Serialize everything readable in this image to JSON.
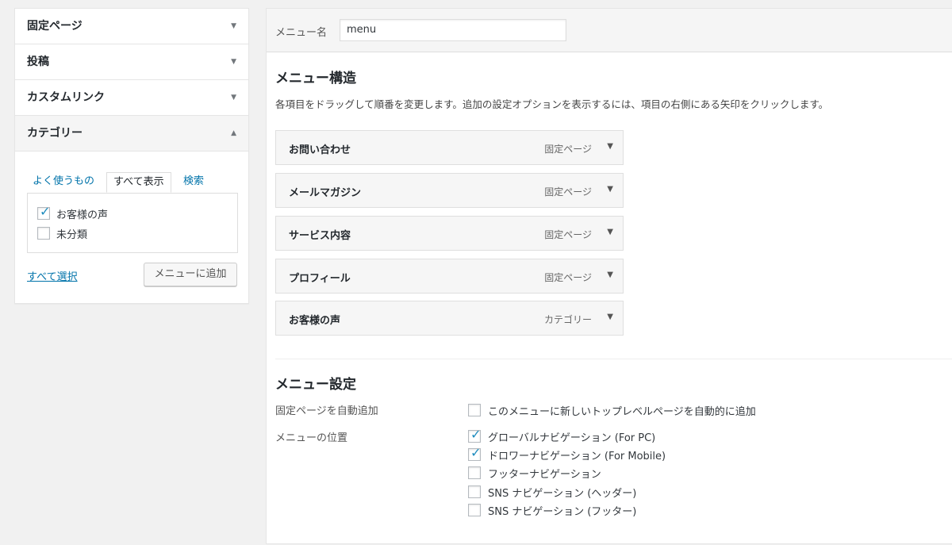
{
  "left_panel": {
    "sections": [
      {
        "label": "固定ページ",
        "arrow": "▼"
      },
      {
        "label": "投稿",
        "arrow": "▼"
      },
      {
        "label": "カスタムリンク",
        "arrow": "▼"
      },
      {
        "label": "カテゴリー",
        "arrow": "▲"
      }
    ],
    "tabs": [
      "よく使うもの",
      "すべて表示",
      "検索"
    ],
    "categories": [
      {
        "label": "お客様の声",
        "checked": true
      },
      {
        "label": "未分類",
        "checked": false
      }
    ],
    "select_all": "すべて選択",
    "add_button": "メニューに追加"
  },
  "main": {
    "menu_name_label": "メニュー名",
    "menu_name_value": "menu",
    "structure_title": "メニュー構造",
    "structure_desc": "各項目をドラッグして順番を変更します。追加の設定オプションを表示するには、項目の右側にある矢印をクリックします。",
    "items": [
      {
        "title": "お問い合わせ",
        "type": "固定ページ"
      },
      {
        "title": "メールマガジン",
        "type": "固定ページ"
      },
      {
        "title": "サービス内容",
        "type": "固定ページ"
      },
      {
        "title": "プロフィール",
        "type": "固定ページ"
      },
      {
        "title": "お客様の声",
        "type": "カテゴリー"
      }
    ],
    "item_arrow": "▼",
    "settings_title": "メニュー設定",
    "auto_add_label": "固定ページを自動追加",
    "auto_add_option": {
      "label": "このメニューに新しいトップレベルページを自動的に追加",
      "checked": false
    },
    "location_label": "メニューの位置",
    "locations": [
      {
        "label": "グローバルナビゲーション (For PC)",
        "checked": true
      },
      {
        "label": "ドロワーナビゲーション (For Mobile)",
        "checked": true
      },
      {
        "label": "フッターナビゲーション",
        "checked": false
      },
      {
        "label": "SNS ナビゲーション (ヘッダー)",
        "checked": false
      },
      {
        "label": "SNS ナビゲーション (フッター)",
        "checked": false
      }
    ],
    "check_glyph": "✓"
  }
}
